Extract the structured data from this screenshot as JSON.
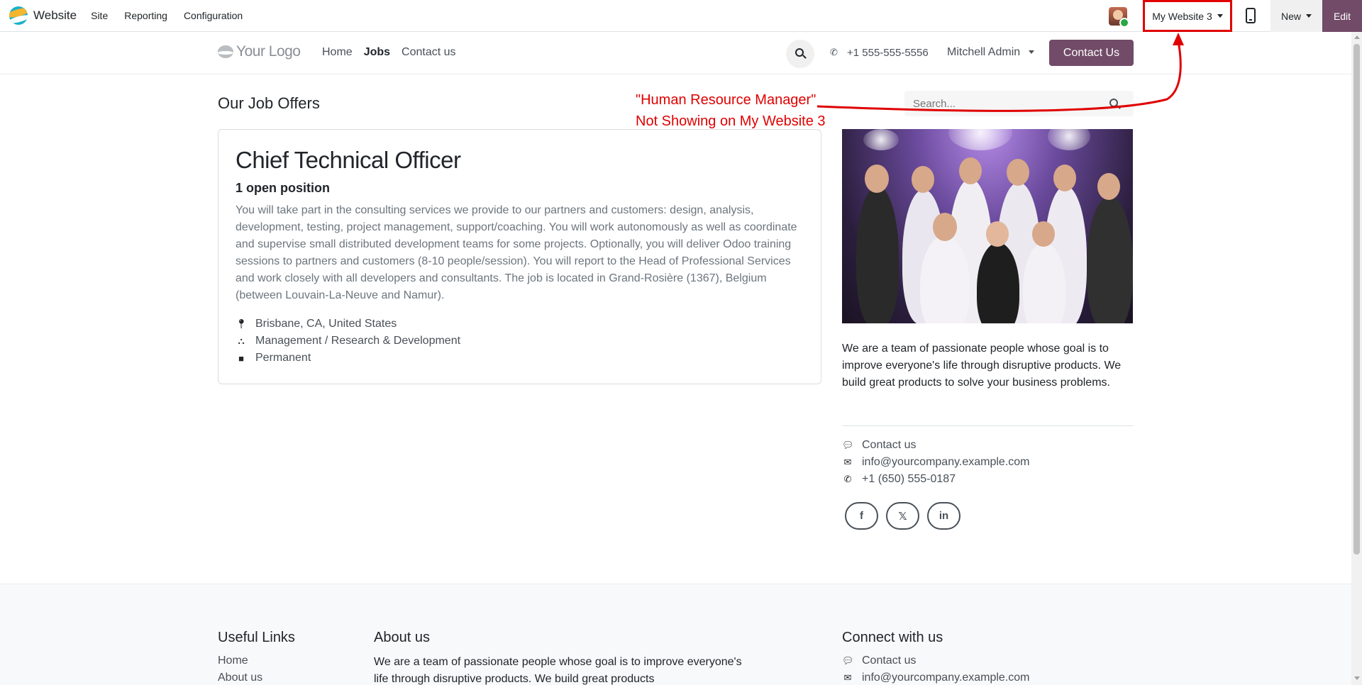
{
  "adminbar": {
    "app_name": "Website",
    "menu": [
      "Site",
      "Reporting",
      "Configuration"
    ],
    "website_switch": "My Website 3",
    "new_label": "New",
    "edit_label": "Edit"
  },
  "header": {
    "logo_text": "Your Logo",
    "nav": [
      "Home",
      "Jobs",
      "Contact us"
    ],
    "phone": "+1 555-555-5556",
    "user": "Mitchell Admin",
    "cta": "Contact Us"
  },
  "main": {
    "title": "Our Job Offers",
    "search_placeholder": "Search...",
    "annotation_line1": "\"Human Resource Manager\"",
    "annotation_line2": "Not Showing on My Website 3",
    "job": {
      "title": "Chief Technical Officer",
      "positions": "1 open position",
      "description": "You will take part in the consulting services we provide to our partners and customers: design, analysis, development, testing, project management, support/coaching. You will work autonomously as well as coordinate and supervise small distributed development teams for some projects. Optionally, you will deliver Odoo training sessions to partners and customers (8-10 people/session). You will report to the Head of Professional Services and work closely with all developers and consultants. The job is located in Grand-Rosière (1367), Belgium (between Louvain-La-Neuve and Namur).",
      "location": "Brisbane, CA, United States",
      "department": "Management / Research & Development",
      "contract": "Permanent"
    },
    "sidebar": {
      "about": "We are a team of passionate people whose goal is to improve everyone's life through disruptive products. We build great products to solve your business problems.",
      "contact_us": "Contact us",
      "email": "info@yourcompany.example.com",
      "phone": "+1 (650) 555-0187",
      "social": [
        "f",
        "𝕏",
        "in"
      ]
    }
  },
  "footer": {
    "useful_links_title": "Useful Links",
    "links": [
      "Home",
      "About us"
    ],
    "about_title": "About us",
    "about_text": "We are a team of passionate people whose goal is to improve everyone's life through disruptive products. We build great products",
    "connect_title": "Connect with us",
    "connect_contact": "Contact us",
    "connect_email": "info@yourcompany.example.com"
  },
  "colors": {
    "brand": "#714b67",
    "annotation": "#e00000"
  }
}
